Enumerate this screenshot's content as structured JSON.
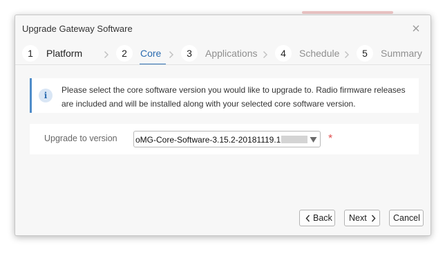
{
  "dialog": {
    "title": "Upgrade Gateway Software",
    "close_icon": "close-icon"
  },
  "steps": [
    {
      "number": "1",
      "label": "Platform",
      "state": "done"
    },
    {
      "number": "2",
      "label": "Core",
      "state": "active"
    },
    {
      "number": "3",
      "label": "Applications",
      "state": "todo"
    },
    {
      "number": "4",
      "label": "Schedule",
      "state": "todo"
    },
    {
      "number": "5",
      "label": "Summary",
      "state": "todo"
    }
  ],
  "info": {
    "icon": "info-icon",
    "text": "Please select the core software version you would like to upgrade to. Radio firmware releases are included and will be installed along with your selected core software version."
  },
  "form": {
    "label": "Upgrade to version",
    "selected_value": "oMG-Core-Software-3.15.2-20181119.1.p",
    "required_mark": "*"
  },
  "buttons": {
    "back": "Back",
    "next": "Next",
    "cancel": "Cancel"
  },
  "colors": {
    "accent": "#2d6fb3",
    "required": "#e05050",
    "info_border": "#4f8cc9"
  }
}
